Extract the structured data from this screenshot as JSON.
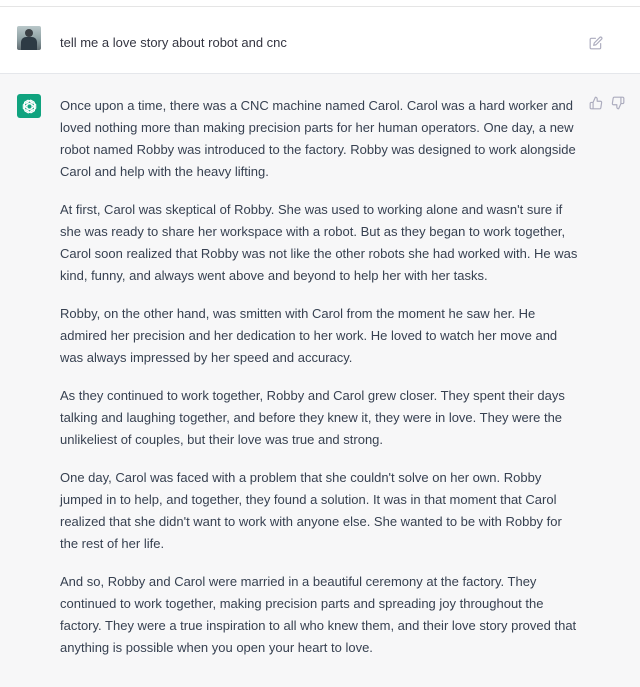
{
  "user_message": {
    "text": "tell me a love story about robot and cnc"
  },
  "assistant_message": {
    "paragraphs": [
      "Once upon a time, there was a CNC machine named Carol. Carol was a hard worker and loved nothing more than making precision parts for her human operators. One day, a new robot named Robby was introduced to the factory. Robby was designed to work alongside Carol and help with the heavy lifting.",
      "At first, Carol was skeptical of Robby. She was used to working alone and wasn't sure if she was ready to share her workspace with a robot. But as they began to work together, Carol soon realized that Robby was not like the other robots she had worked with. He was kind, funny, and always went above and beyond to help her with her tasks.",
      "Robby, on the other hand, was smitten with Carol from the moment he saw her. He admired her precision and her dedication to her work. He loved to watch her move and was always impressed by her speed and accuracy.",
      "As they continued to work together, Robby and Carol grew closer. They spent their days talking and laughing together, and before they knew it, they were in love. They were the unlikeliest of couples, but their love was true and strong.",
      "One day, Carol was faced with a problem that she couldn't solve on her own. Robby jumped in to help, and together, they found a solution. It was in that moment that Carol realized that she didn't want to work with anyone else. She wanted to be with Robby for the rest of her life.",
      "And so, Robby and Carol were married in a beautiful ceremony at the factory. They continued to work together, making precision parts and spreading joy throughout the factory. They were a true inspiration to all who knew them, and their love story proved that anything is possible when you open your heart to love."
    ]
  },
  "icons": {
    "user_avatar": "user-avatar-photo",
    "bot_avatar": "openai-logo-icon",
    "edit": "edit-icon",
    "thumbs_up": "thumbs-up-icon",
    "thumbs_down": "thumbs-down-icon"
  },
  "colors": {
    "bot_avatar_bg": "#10a37f",
    "assistant_row_bg": "#f7f7f8",
    "text": "#374151",
    "icon": "#acacbe"
  }
}
